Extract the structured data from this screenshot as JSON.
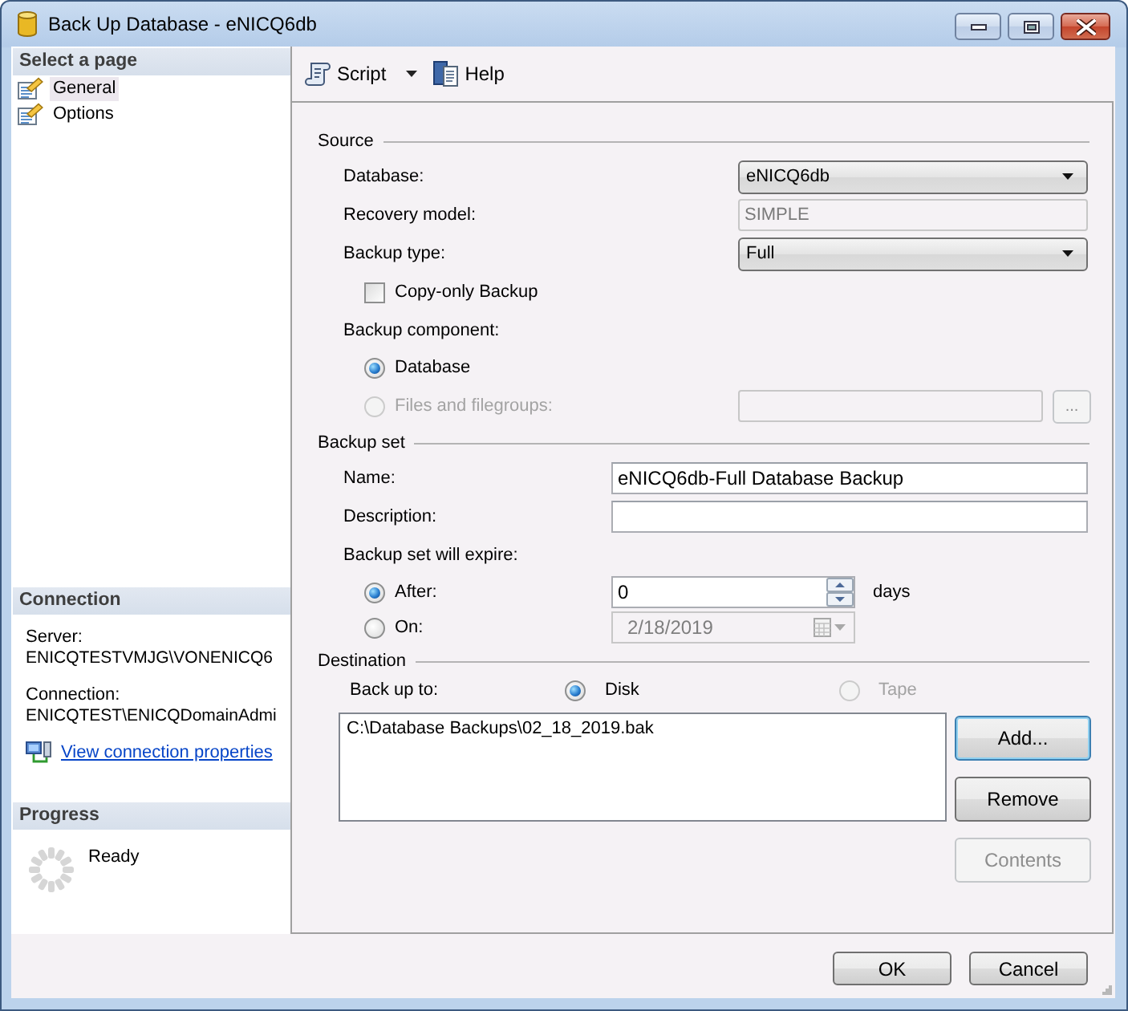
{
  "window": {
    "title": "Back Up Database - eNICQ6db"
  },
  "sidebar": {
    "header": "Select a page",
    "pages": [
      {
        "label": "General",
        "selected": true
      },
      {
        "label": "Options",
        "selected": false
      }
    ]
  },
  "connection": {
    "header": "Connection",
    "server_label": "Server:",
    "server": "ENICQTESTVMJG\\VONENICQ6",
    "connection_label": "Connection:",
    "connection": "ENICQTEST\\ENICQDomainAdmi",
    "link": "View connection properties"
  },
  "progress": {
    "header": "Progress",
    "status": "Ready"
  },
  "toolbar": {
    "items": [
      {
        "label": "Script",
        "kind": "dropdown"
      },
      {
        "label": "Help",
        "kind": "button"
      }
    ]
  },
  "source": {
    "title": "Source",
    "rows": [
      {
        "kind": "dropdown",
        "label": "Database:",
        "value": "eNICQ6db"
      },
      {
        "kind": "readonly",
        "label": "Recovery model:",
        "value": "SIMPLE"
      },
      {
        "kind": "dropdown",
        "label": "Backup type:",
        "value": "Full"
      },
      {
        "kind": "checkbox",
        "label": "Copy-only Backup",
        "checked": false
      },
      {
        "kind": "heading",
        "label": "Backup component:"
      },
      {
        "kind": "radio",
        "label": "Database",
        "selected": true,
        "disabled": false
      },
      {
        "kind": "radio_browse",
        "label": "Files and filegroups:",
        "selected": false,
        "disabled": true,
        "button": "..."
      }
    ]
  },
  "backup_set": {
    "title": "Backup set",
    "rows": [
      {
        "kind": "text",
        "label": "Name:",
        "value": "eNICQ6db-Full Database Backup"
      },
      {
        "kind": "text",
        "label": "Description:"
      },
      {
        "kind": "heading",
        "label": "Backup set will expire:"
      },
      {
        "kind": "radio_spin",
        "label": "After:",
        "selected": true,
        "value": "0",
        "unit": "days"
      },
      {
        "kind": "radio_date",
        "label": "On:",
        "selected": false,
        "disabled": true,
        "value": "2/18/2019"
      }
    ]
  },
  "destination": {
    "title": "Destination",
    "target_label": "Back up to:",
    "targets": [
      {
        "label": "Disk",
        "selected": true,
        "disabled": false
      },
      {
        "label": "Tape",
        "selected": false,
        "disabled": true
      }
    ],
    "files": [
      "C:\\Database Backups\\02_18_2019.bak"
    ],
    "buttons": [
      {
        "label": "Add...",
        "disabled": false,
        "focused": true
      },
      {
        "label": "Remove",
        "disabled": false,
        "focused": false
      },
      {
        "label": "Contents",
        "disabled": true,
        "focused": false
      }
    ]
  },
  "footer": {
    "buttons": [
      "OK",
      "Cancel"
    ]
  }
}
